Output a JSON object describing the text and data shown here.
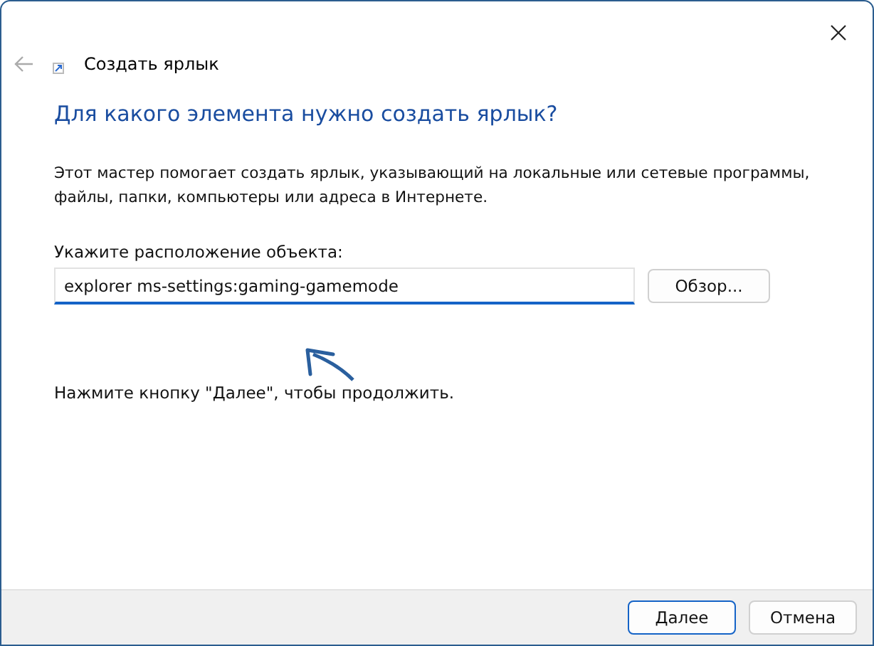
{
  "window": {
    "title": "Создать ярлык"
  },
  "heading": "Для какого элемента нужно создать ярлык?",
  "description": "Этот мастер помогает создать ярлык, указывающий на локальные или сетевые программы, файлы, папки, компьютеры или адреса в Интернете.",
  "location": {
    "label": "Укажите расположение объекта:",
    "value": "explorer ms-settings:gaming-gamemode",
    "browse_button": "Обзор..."
  },
  "hint": "Нажмите кнопку \"Далее\", чтобы продолжить.",
  "buttons": [
    {
      "label": "Далее",
      "selected": true
    },
    {
      "label": "Отмена",
      "selected": false
    }
  ]
}
